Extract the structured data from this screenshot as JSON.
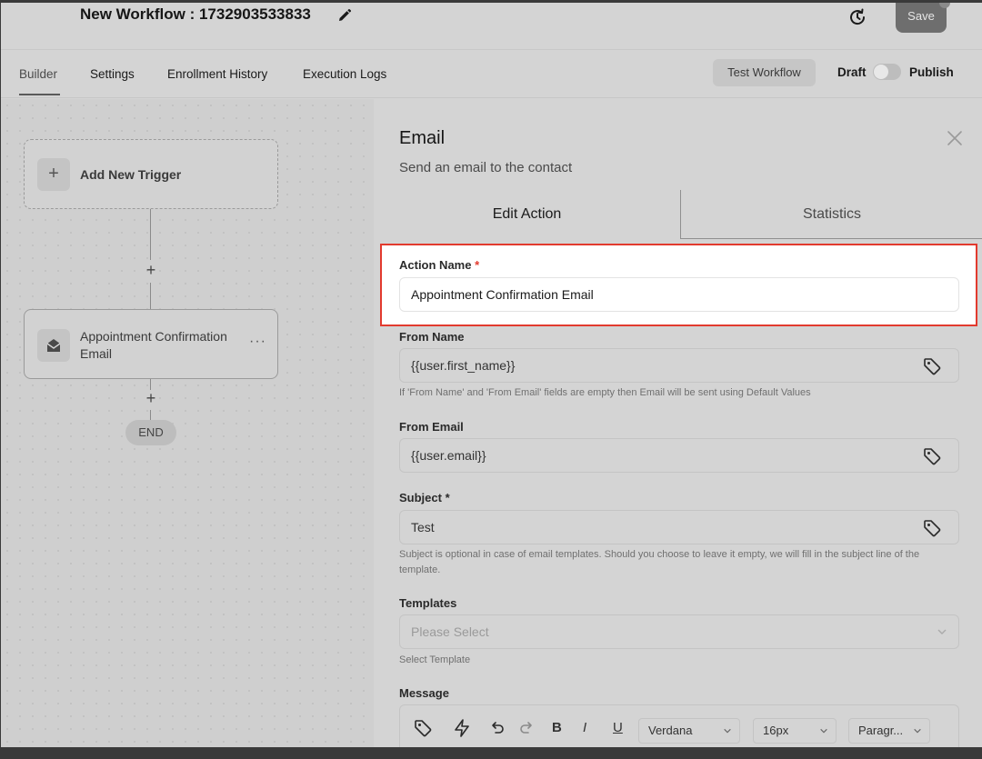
{
  "header": {
    "workflow_title": "New Workflow : 1732903533833",
    "save_label": "Save"
  },
  "tabs": [
    {
      "label": "Builder",
      "active": true
    },
    {
      "label": "Settings"
    },
    {
      "label": "Enrollment History"
    },
    {
      "label": "Execution Logs"
    }
  ],
  "actions": {
    "test_label": "Test Workflow",
    "draft_label": "Draft",
    "publish_label": "Publish",
    "published": false
  },
  "canvas": {
    "trigger_label": "Add New Trigger",
    "plus_symbol": "+",
    "email_step_label": "Appointment Confirmation Email",
    "more_symbol": "···",
    "end_label": "END"
  },
  "panel": {
    "title": "Email",
    "subtitle": "Send an email to the contact",
    "tab_edit": "Edit Action",
    "tab_stats": "Statistics",
    "action_name_label": "Action Name",
    "action_name_required": "*",
    "action_name_value": "Appointment Confirmation Email",
    "from_name_label": "From Name",
    "from_name_value": "{{user.first_name}}",
    "from_hint": "If 'From Name' and 'From Email' fields are empty then Email will be sent using Default Values",
    "from_email_label": "From Email",
    "from_email_value": "{{user.email}}",
    "subject_label": "Subject *",
    "subject_value": "Test",
    "subject_hint": "Subject is optional in case of email templates. Should you choose to leave it empty, we will fill in the subject line of the template.",
    "templates_label": "Templates",
    "templates_placeholder": "Please Select",
    "templates_hint": "Select Template",
    "message_label": "Message",
    "toolbar": {
      "font": "Verdana",
      "size": "16px",
      "block": "Paragr...",
      "bold": "B",
      "italic": "I",
      "underline": "U"
    }
  },
  "colors": {
    "highlight_border": "#e23a2e",
    "required_star": "#e23a2e"
  }
}
